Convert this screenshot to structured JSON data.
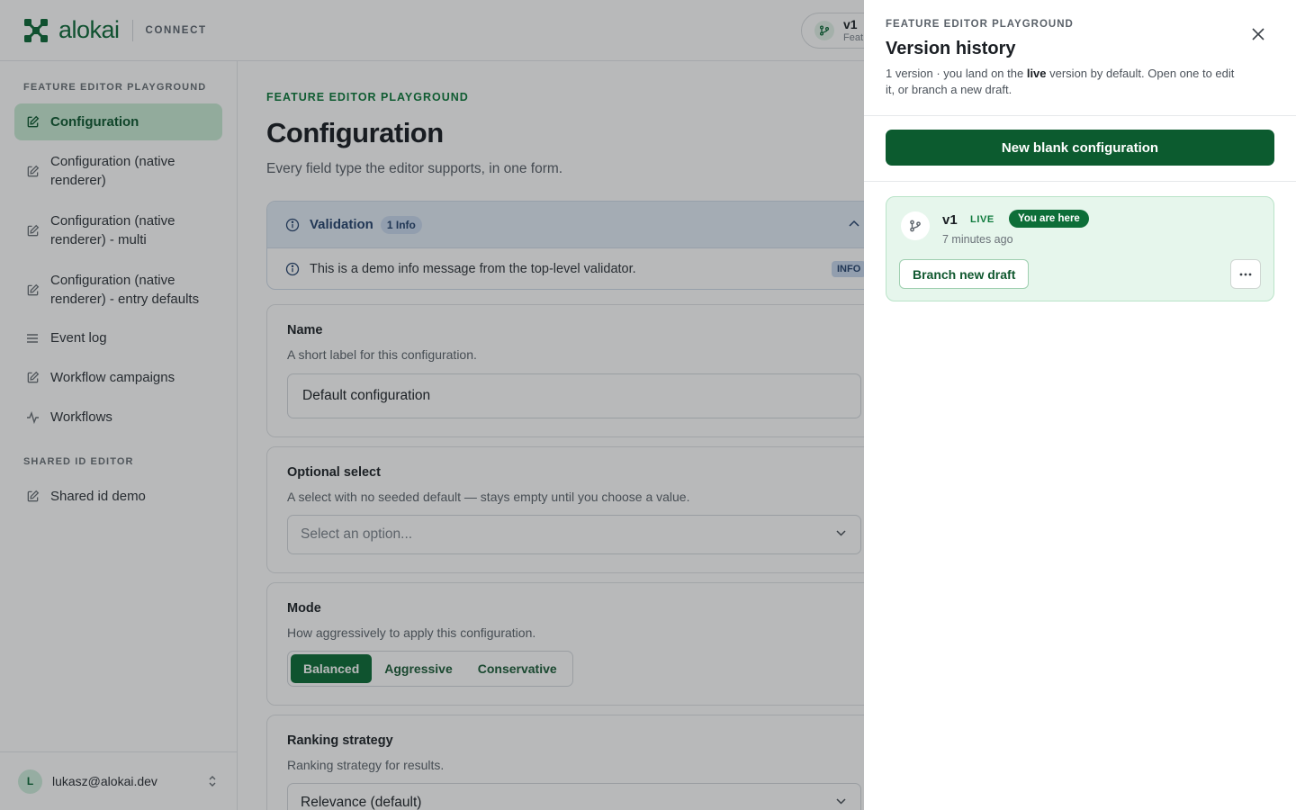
{
  "header": {
    "brand_name": "alokai",
    "product": "CONNECT",
    "version_chip": {
      "title": "v1",
      "subtitle": "Feat"
    }
  },
  "sidebar": {
    "section1": "FEATURE EDITOR PLAYGROUND",
    "items": [
      {
        "label": "Configuration",
        "icon": "edit-icon",
        "active": true
      },
      {
        "label": "Configuration (native renderer)",
        "icon": "edit-icon"
      },
      {
        "label": "Configuration (native renderer) - multi",
        "icon": "edit-icon"
      },
      {
        "label": "Configuration (native renderer) - entry defaults",
        "icon": "edit-icon"
      },
      {
        "label": "Event log",
        "icon": "list-icon"
      },
      {
        "label": "Workflow campaigns",
        "icon": "edit-icon"
      },
      {
        "label": "Workflows",
        "icon": "activity-icon"
      }
    ],
    "section2": "SHARED ID EDITOR",
    "items2": [
      {
        "label": "Shared id demo",
        "icon": "edit-icon"
      }
    ],
    "user": {
      "initial": "L",
      "email": "lukasz@alokai.dev"
    }
  },
  "main": {
    "eyebrow": "FEATURE EDITOR PLAYGROUND",
    "title": "Configuration",
    "subtitle": "Every field type the editor supports, in one form.",
    "validation": {
      "title": "Validation",
      "badge": "1 Info",
      "message": "This is a demo info message from the top-level validator.",
      "tag": "INFO"
    },
    "name_field": {
      "label": "Name",
      "help": "A short label for this configuration.",
      "value": "Default configuration"
    },
    "optional_select": {
      "label": "Optional select",
      "help": "A select with no seeded default — stays empty until you choose a value.",
      "placeholder": "Select an option..."
    },
    "mode": {
      "label": "Mode",
      "help": "How aggressively to apply this configuration.",
      "options": [
        "Balanced",
        "Aggressive",
        "Conservative"
      ],
      "selected": "Balanced"
    },
    "ranking": {
      "label": "Ranking strategy",
      "help": "Ranking strategy for results.",
      "value": "Relevance (default)"
    }
  },
  "drawer": {
    "eyebrow": "FEATURE EDITOR PLAYGROUND",
    "title": "Version history",
    "desc_pre": "1 version · you land on the ",
    "desc_bold": "live",
    "desc_post": " version by default. Open one to edit it, or branch a new draft.",
    "new_button": "New blank configuration",
    "versions": [
      {
        "name": "v1",
        "status": "LIVE",
        "current_badge": "You are here",
        "time": "7 minutes ago",
        "branch_label": "Branch new draft"
      }
    ]
  },
  "colors": {
    "brand": "#0f6b3a",
    "primary_button": "#0c5b2f",
    "active_nav": "#c9ebd5",
    "validation_header": "#e3ecf7"
  }
}
